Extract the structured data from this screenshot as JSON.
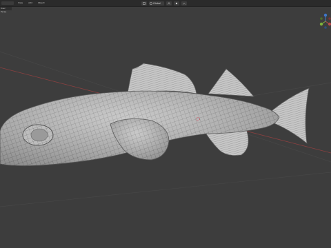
{
  "header": {
    "menu": [
      "",
      "View",
      "Add",
      "Object"
    ],
    "shading_mode": "Global"
  },
  "viewport": {
    "sub_label": "User Persp"
  },
  "colors": {
    "background": "#3d3d3d",
    "header": "#2b2b2b",
    "mesh_fill": "#bcbcbc",
    "mesh_wire": "#6a6a6a",
    "x_axis": "#b84a4a",
    "y_axis": "#7fb33a",
    "z_axis": "#3f76c9",
    "accent": "#5680c2"
  },
  "icons": [
    "select-box-icon",
    "global-transform-icon",
    "snap-icon",
    "proportional-edit-icon",
    "falloff-icon",
    "navigation-gizmo-icon",
    "3d-cursor-icon"
  ]
}
